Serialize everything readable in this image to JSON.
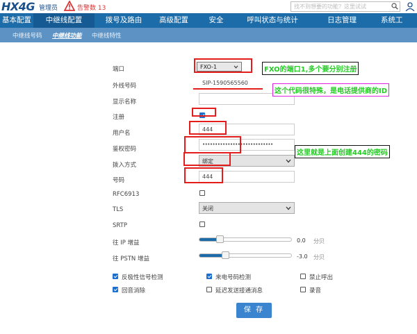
{
  "header": {
    "logo": "HX4G",
    "admin": "管理员",
    "alarm": "告警数 13",
    "search_placeholder": "找不到想要的功能？这里试试"
  },
  "nav": [
    {
      "label": "基本配置",
      "active": false
    },
    {
      "label": "中继线配置",
      "active": true
    },
    {
      "label": "拨号及路由",
      "active": false
    },
    {
      "label": "高级配置",
      "active": false
    },
    {
      "label": "安全",
      "active": false
    },
    {
      "label": "呼叫状态与统计",
      "active": false
    },
    {
      "label": "日志管理",
      "active": false
    },
    {
      "label": "系统工",
      "active": false
    }
  ],
  "subnav": [
    {
      "label": "中继线号码",
      "active": false
    },
    {
      "label": "中继线功能",
      "active": true
    },
    {
      "label": "中继线特性",
      "active": false
    }
  ],
  "form": {
    "port_label": "端口",
    "port_value": "FXO-1",
    "ext_label": "外线号码",
    "ext_value": "SIP-1590565560",
    "display_label": "显示名称",
    "display_value": "",
    "register_label": "注册",
    "register_checked": true,
    "username_label": "用户名",
    "username_value": "444",
    "password_label": "鉴权密码",
    "password_value": "••••••••••••••••••••••••••••",
    "access_label": "拨入方式",
    "access_value": "绑定",
    "number_label": "号码",
    "number_value": "444",
    "rfc_label": "RFC6913",
    "rfc_checked": false,
    "tls_label": "TLS",
    "tls_value": "关闭",
    "srtp_label": "SRTP",
    "srtp_checked": false,
    "ip_gain_label": "往 IP 增益",
    "ip_gain_value": "0.0",
    "pstn_gain_label": "往 PSTN 增益",
    "pstn_gain_value": "-3.0",
    "gain_unit": "分贝",
    "ip_gain_level": 0.22,
    "pstn_gain_level": 0.28
  },
  "options": [
    {
      "label": "反极性信号检测",
      "checked": true
    },
    {
      "label": "来电号码检测",
      "checked": true
    },
    {
      "label": "禁止呼出",
      "checked": false
    },
    {
      "label": "回音消除",
      "checked": true
    },
    {
      "label": "延迟发送接通消息",
      "checked": false
    },
    {
      "label": "录音",
      "checked": false
    }
  ],
  "save_label": "保 存",
  "annotations": {
    "port_note": "FXO的端口1,多个要分别注册",
    "id_note": "这个代码很特殊，是电话提供商的ID",
    "pwd_note": "这里就是上面创建444的密码"
  },
  "colors": {
    "nav_bg": "#1c6ca9",
    "subnav_bg": "#5c93c4",
    "annotation_red": "#e51c1c",
    "annotation_green": "#22cc22",
    "annotation_magenta": "#e020e0"
  }
}
